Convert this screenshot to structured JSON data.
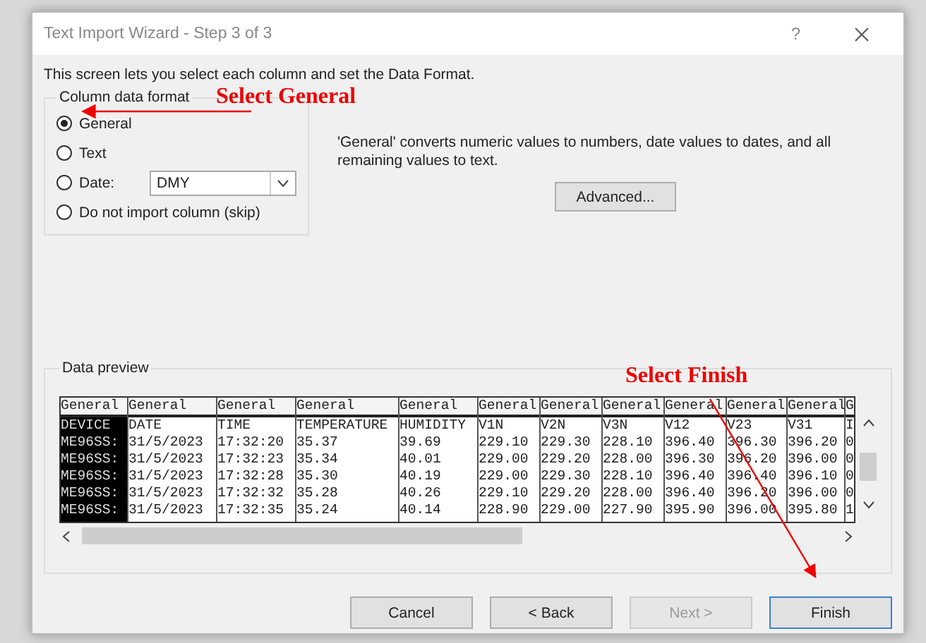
{
  "window": {
    "title": "Text Import Wizard - Step 3 of 3",
    "help": "?"
  },
  "intro": "This screen lets you select each column and set the Data Format.",
  "column_data_format": {
    "legend": "Column data format",
    "options": [
      {
        "kind": "plain",
        "label": "General",
        "selected": true
      },
      {
        "kind": "plain",
        "label": "Text",
        "selected": false
      },
      {
        "kind": "date",
        "label": "Date:",
        "selected": false,
        "dropdown": "DMY"
      },
      {
        "kind": "plain",
        "label": "Do not import column (skip)",
        "selected": false
      }
    ]
  },
  "description": "'General' converts numeric values to numbers, date values to dates, and all remaining values to text.",
  "advanced_button": "Advanced...",
  "data_preview": {
    "legend": "Data preview",
    "columns": [
      {
        "header": "General",
        "selected": true
      },
      {
        "header": "General",
        "selected": false
      },
      {
        "header": "General",
        "selected": false
      },
      {
        "header": "General",
        "selected": false
      },
      {
        "header": "General",
        "selected": false
      },
      {
        "header": "General",
        "selected": false
      },
      {
        "header": "General",
        "selected": false
      },
      {
        "header": "General",
        "selected": false
      },
      {
        "header": "General",
        "selected": false
      },
      {
        "header": "General",
        "selected": false
      },
      {
        "header": "General",
        "selected": false
      },
      {
        "header": "G",
        "selected": false
      }
    ],
    "rows": [
      [
        "DEVICE",
        "DATE",
        "TIME",
        "TEMPERATURE",
        "HUMIDITY",
        "V1N",
        "V2N",
        "V3N",
        "V12",
        "V23",
        "V31",
        "I"
      ],
      [
        "ME96SS:",
        "31/5/2023",
        "17:32:20",
        "35.37",
        "39.69",
        "229.10",
        "229.30",
        "228.10",
        "396.40",
        "396.30",
        "396.20",
        "0"
      ],
      [
        "ME96SS:",
        "31/5/2023",
        "17:32:23",
        "35.34",
        "40.01",
        "229.00",
        "229.20",
        "228.00",
        "396.30",
        "396.20",
        "396.00",
        "0"
      ],
      [
        "ME96SS:",
        "31/5/2023",
        "17:32:28",
        "35.30",
        "40.19",
        "229.00",
        "229.30",
        "228.10",
        "396.40",
        "396.40",
        "396.10",
        "0"
      ],
      [
        "ME96SS:",
        "31/5/2023",
        "17:32:32",
        "35.28",
        "40.26",
        "229.10",
        "229.20",
        "228.00",
        "396.40",
        "396.20",
        "396.00",
        "0"
      ],
      [
        "ME96SS:",
        "31/5/2023",
        "17:32:35",
        "35.24",
        "40.14",
        "228.90",
        "229.00",
        "227.90",
        "395.90",
        "396.00",
        "395.80",
        "1"
      ]
    ]
  },
  "buttons": [
    {
      "label": "Cancel",
      "disabled": false,
      "focused": false
    },
    {
      "label": "< Back",
      "disabled": false,
      "focused": false
    },
    {
      "label": "Next >",
      "disabled": true,
      "focused": false
    },
    {
      "label": "Finish",
      "disabled": false,
      "focused": true
    }
  ],
  "annotations": [
    {
      "text": "Select General"
    },
    {
      "text": "Select Finish"
    }
  ]
}
